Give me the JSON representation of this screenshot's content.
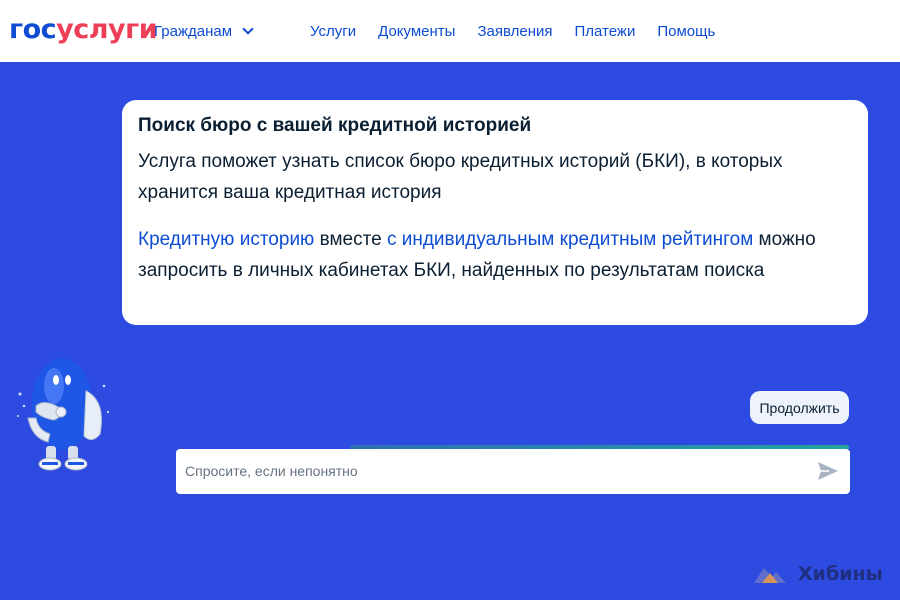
{
  "header": {
    "logo_part1": "гос",
    "logo_part2": "услуги",
    "citizen_label": "Гражданам",
    "nav": [
      {
        "label": "Услуги"
      },
      {
        "label": "Документы"
      },
      {
        "label": "Заявления"
      },
      {
        "label": "Платежи"
      },
      {
        "label": "Помощь"
      }
    ]
  },
  "card": {
    "title": "Поиск бюро с вашей кредитной историей",
    "description": "Услуга поможет узнать список бюро кредитных историй (БКИ), в которых хранится ваша кредитная история",
    "info_link1": "Кредитную историю",
    "info_mid": " вместе ",
    "info_link2": "с индивидуальным кредитным рейтингом",
    "info_rest": " можно запросить в личных кабинетах БКИ, найденных по результатам поиска"
  },
  "actions": {
    "continue_label": "Продолжить"
  },
  "chat": {
    "placeholder": "Спросите, если непонятно"
  },
  "watermark": {
    "text": "Хибины"
  },
  "colors": {
    "background": "#2d4be0",
    "brand_blue": "#0d4cd3",
    "brand_red": "#ee3f58",
    "text_dark": "#0b1f33"
  },
  "icons": {
    "citizen_dropdown": "chevron-down-icon",
    "send": "send-icon",
    "mascot": "robot-mascot-icon",
    "watermark": "mountain-logo-icon"
  }
}
